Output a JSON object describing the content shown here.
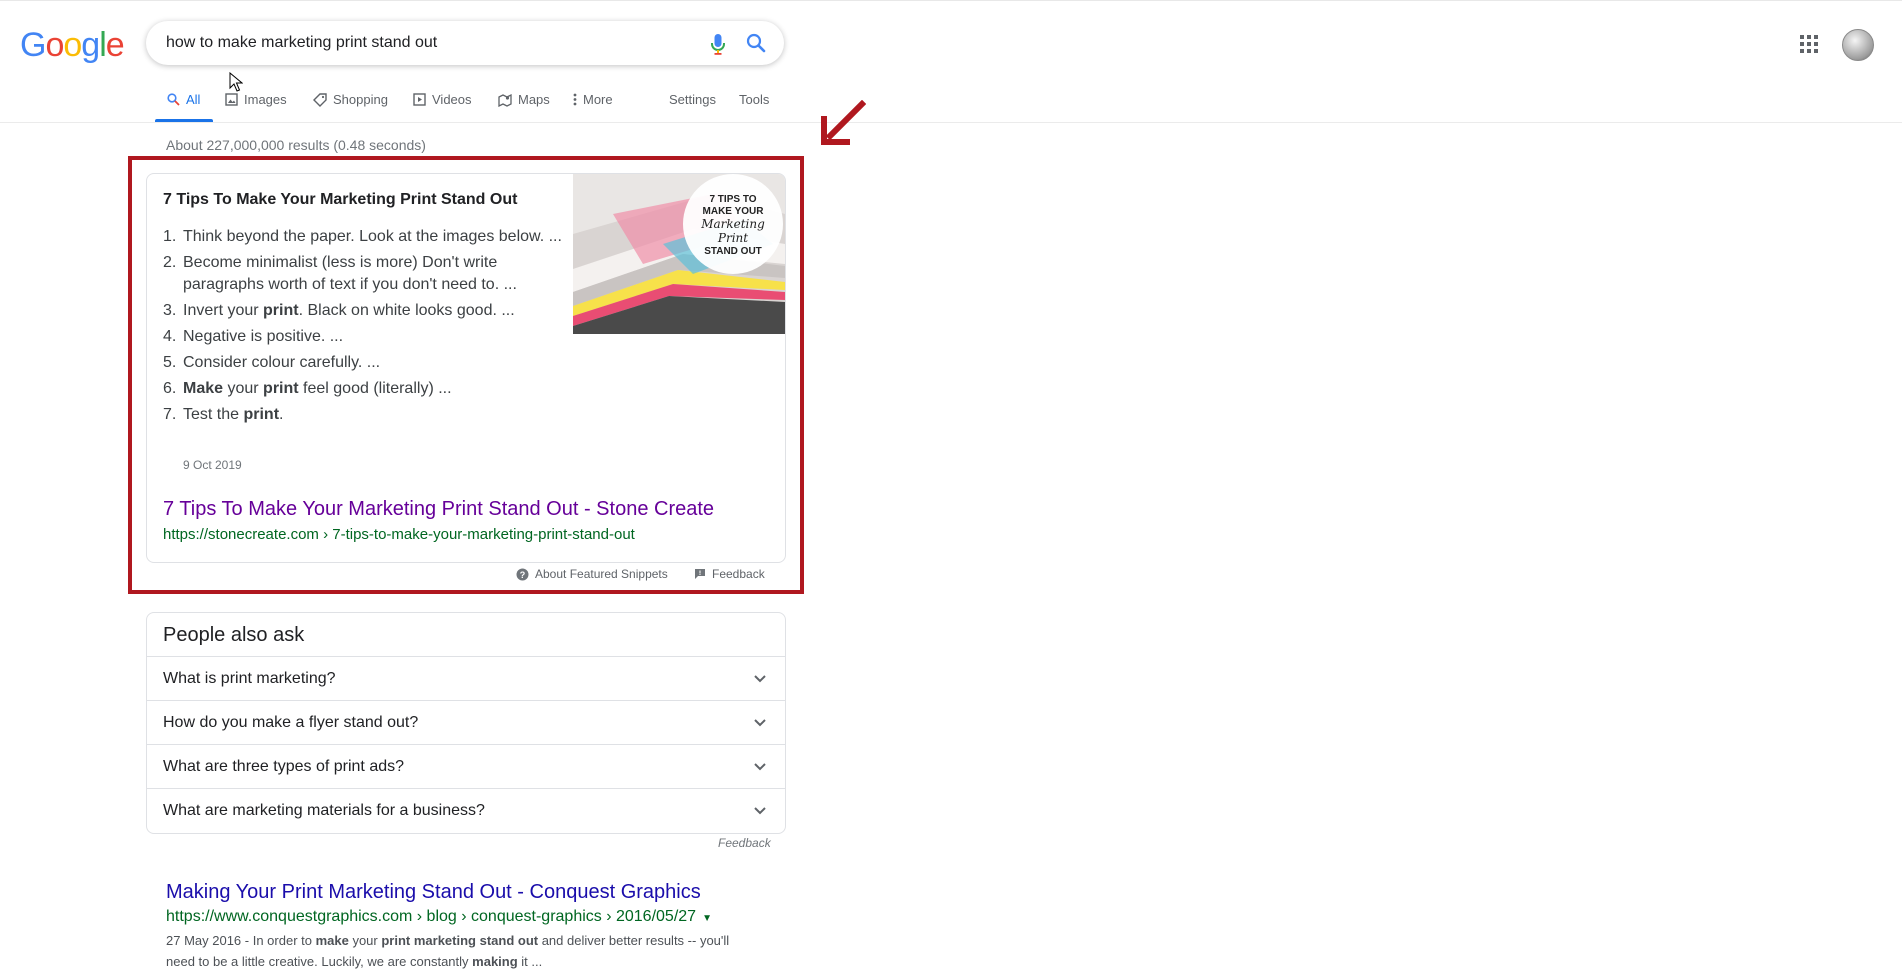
{
  "header": {
    "logo": "Google",
    "search": {
      "query": "how to make marketing print stand out"
    },
    "tabs": [
      {
        "label": "All",
        "icon": "search-icon"
      },
      {
        "label": "Images",
        "icon": "image-icon"
      },
      {
        "label": "Shopping",
        "icon": "tag-icon"
      },
      {
        "label": "Videos",
        "icon": "play-icon"
      },
      {
        "label": "Maps",
        "icon": "map-icon"
      },
      {
        "label": "More",
        "icon": "more-dots-icon"
      }
    ],
    "settings_label": "Settings",
    "tools_label": "Tools"
  },
  "stats": "About 227,000,000 results (0.48 seconds)",
  "featured_snippet": {
    "title": "7 Tips To Make Your Marketing Print Stand Out",
    "image_text": [
      "7 TIPS TO",
      "MAKE YOUR",
      "Marketing",
      "Print",
      "STAND OUT"
    ],
    "items": [
      {
        "num": "1.",
        "html": "Think beyond the paper. Look at the images below. ..."
      },
      {
        "num": "2.",
        "html": "Become minimalist (less is more) Don't write paragraphs worth of text if you don't need to. ..."
      },
      {
        "num": "3.",
        "html": "Invert your <b>print</b>. Black on white looks good. ..."
      },
      {
        "num": "4.",
        "html": "Negative is positive. ..."
      },
      {
        "num": "5.",
        "html": "Consider colour carefully. ..."
      },
      {
        "num": "6.",
        "html": "<b>Make</b> your <b>print</b> feel good (literally) ..."
      },
      {
        "num": "7.",
        "html": "Test the <b>print</b>."
      }
    ],
    "date": "9 Oct 2019",
    "link_title": "7 Tips To Make Your Marketing Print Stand Out - Stone Create",
    "url": "https://stonecreate.com › 7-tips-to-make-your-marketing-print-stand-out",
    "about_label": "About Featured Snippets",
    "feedback_label": "Feedback"
  },
  "people_also_ask": {
    "title": "People also ask",
    "questions": [
      "What is print marketing?",
      "How do you make a flyer stand out?",
      "What are three types of print ads?",
      "What are marketing materials for a business?"
    ],
    "feedback_label": "Feedback"
  },
  "result": {
    "title": "Making Your Print Marketing Stand Out - Conquest Graphics",
    "url": "https://www.conquestgraphics.com › blog › conquest-graphics › 2016/05/27",
    "desc_html": "27 May 2016 - In order to <b>make</b> your <b>print marketing stand out</b> and deliver better results -- you'll need to be a little creative. Luckily, we are constantly <b>making</b> it ..."
  },
  "colors": {
    "accent": "#1a73e8",
    "link": "#1a0dab",
    "visited": "#660099",
    "url": "#006621",
    "highlight_frame": "#b0181f"
  }
}
